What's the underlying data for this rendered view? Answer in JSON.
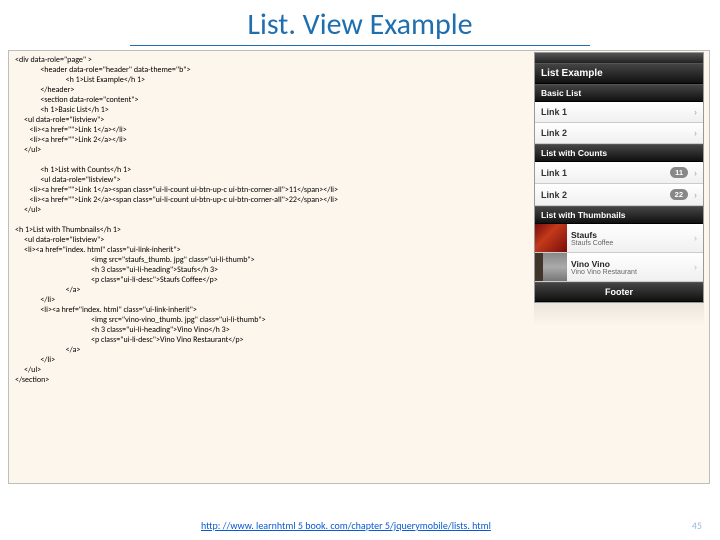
{
  "title": "List. View Example",
  "codebox": {
    "l1": "<div data-role=\"page\" >",
    "l2": "              <header data-role=\"header\" data-theme=\"b\">",
    "l3": "                            <h 1>List Example</h 1>",
    "l4": "              </header>",
    "l5": "              <section data-role=\"content\">",
    "l6": "              <h 1>Basic List</h 1>",
    "l7": "     <ul data-role=\"listview\">",
    "l8": "        <li><a href=\"\">Link 1</a></li>",
    "l9": "        <li><a href=\"\">Link 2</a></li>",
    "l10": "     </ul>",
    "l11": "",
    "l12": "              <h 1>List with Counts</h 1>",
    "l13": "              <ul data-role=\"listview\">",
    "l14": "        <li><a href=\"\">Link 1</a><span class=\"ui-li-count ui-btn-up-c ui-btn-corner-all\">11</span></li>",
    "l15": "        <li><a href=\"\">Link 2</a><span class=\"ui-li-count ui-btn-up-c ui-btn-corner-all\">22</span></li>",
    "l16": "     </ul>",
    "l17": "",
    "l18": "<h 1>List with Thumbnails</h 1>",
    "l19": "     <ul data-role=\"listview\">",
    "l20": "     <li><a href=\"index. html\" class=\"ui-link-inherit\">",
    "l21": "                                          <img src=\"staufs_thumb. jpg\" class=\"ui-li-thumb\">",
    "l22": "                                          <h 3 class=\"ui-li-heading\">Staufs</h 3>",
    "l23": "                                          <p class=\"ui-li-desc\">Staufs Coffee</p>",
    "l24": "                            </a>",
    "l25": "              </li>",
    "l26": "              <li><a href=\"index. html\" class=\"ui-link-inherit\">",
    "l27": "                                          <img src=\"vino-vino_thumb. jpg\" class=\"ui-li-thumb\">",
    "l28": "                                          <h 3 class=\"ui-li-heading\">Vino Vino</h 3>",
    "l29": "                                          <p class=\"ui-li-desc\">Vino Vino Restaurant</p>",
    "l30": "                            </a>",
    "l31": "              </li>",
    "l32": "     </ul>",
    "l33": "</section>"
  },
  "phone": {
    "header": "List Example",
    "sec1": "Basic List",
    "link1": "Link 1",
    "link2": "Link 2",
    "sec2": "List with Counts",
    "count1": "11",
    "count2": "22",
    "sec3": "List with Thumbnails",
    "t1h": "Staufs",
    "t1d": "Staufs Coffee",
    "t2h": "Vino Vino",
    "t2d": "Vino Vino Restaurant",
    "footer": "Footer",
    "chev": "›"
  },
  "link": "http: //www. learnhtml 5 book. com/chapter 5/jquerymobile/lists. html",
  "page_num": "45"
}
